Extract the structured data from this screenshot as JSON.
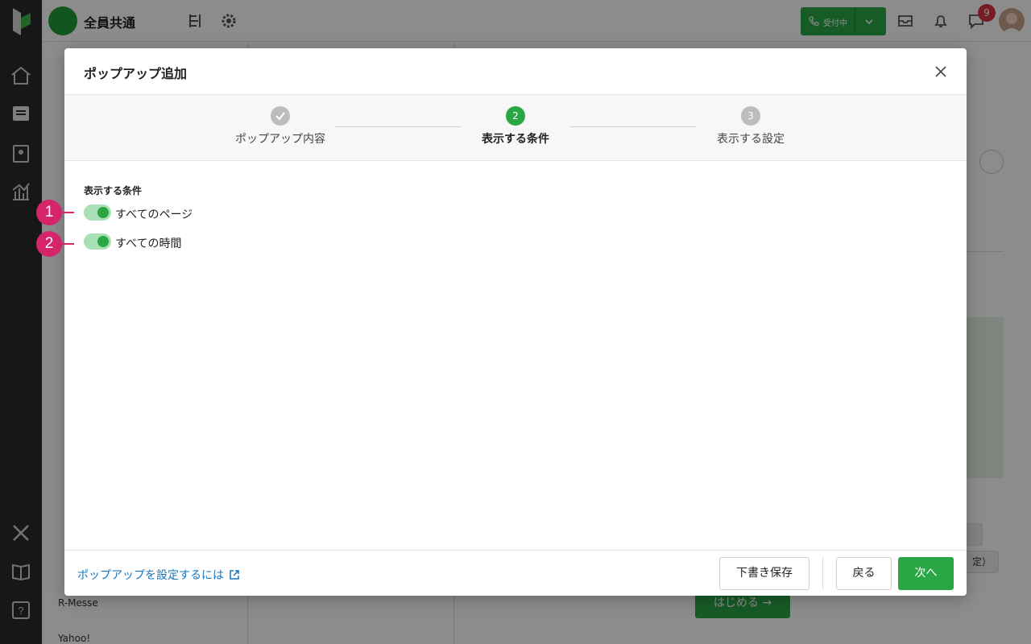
{
  "app": {
    "workspace_name": "全員共通",
    "status_label": "受付中",
    "notification_count": "9"
  },
  "background": {
    "sidebar_items": [
      "R-Messe",
      "Yahoo!"
    ],
    "start_button": "はじめる →",
    "ghost_text": "定）"
  },
  "modal": {
    "title": "ポップアップ追加",
    "steps": [
      {
        "number": "1",
        "label": "ポップアップ内容",
        "state": "done"
      },
      {
        "number": "2",
        "label": "表示する条件",
        "state": "active"
      },
      {
        "number": "3",
        "label": "表示する設定",
        "state": "todo"
      }
    ],
    "section_title": "表示する条件",
    "toggles": [
      {
        "label": "すべてのページ",
        "on": true
      },
      {
        "label": "すべての時間",
        "on": true
      }
    ],
    "footer": {
      "help_link": "ポップアップを設定するには",
      "draft_button": "下書き保存",
      "back_button": "戻る",
      "next_button": "次へ"
    }
  },
  "annotations": [
    "1",
    "2"
  ],
  "colors": {
    "accent": "#2aa745",
    "toggle_track": "#a8dfb3",
    "link": "#1576bd",
    "marker": "#d6246b",
    "rail": "#2b2b2b"
  }
}
